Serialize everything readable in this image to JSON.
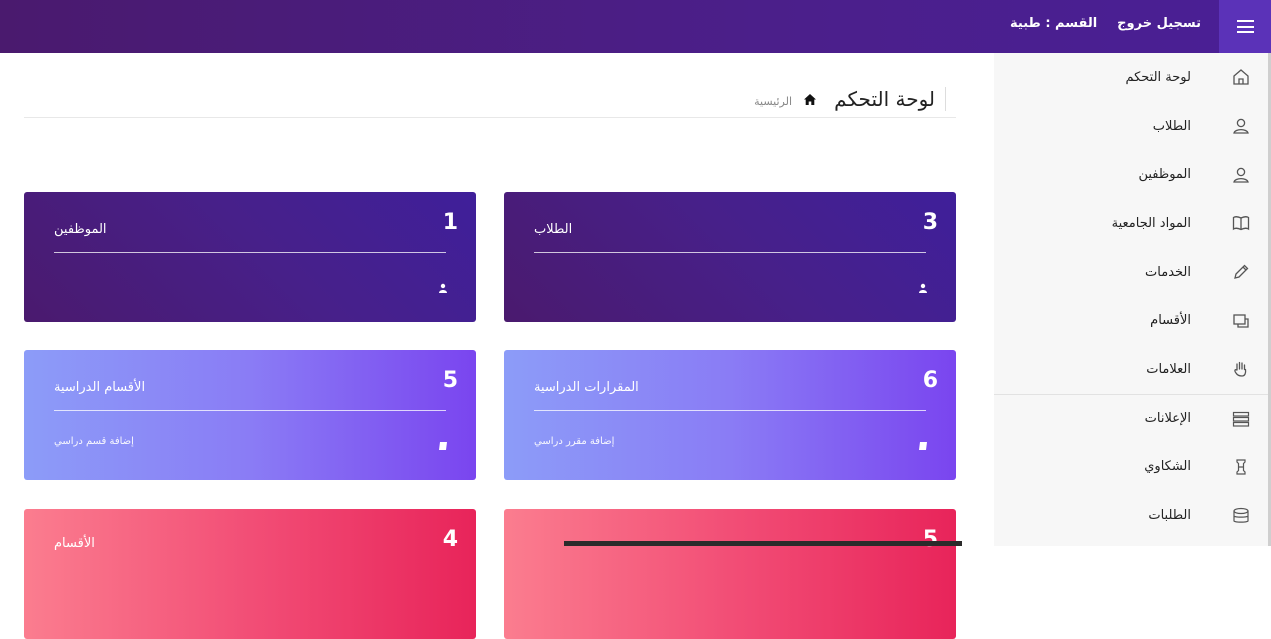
{
  "topbar": {
    "logout_label": "تسجيل خروج",
    "section_label": "القسم : ",
    "section_value": "طبية"
  },
  "sidebar": {
    "items": [
      {
        "label": "لوحة التحكم",
        "icon": "home-icon"
      },
      {
        "label": "الطلاب",
        "icon": "user-icon"
      },
      {
        "label": "الموظفين",
        "icon": "user-icon"
      },
      {
        "label": "المواد الجامعية",
        "icon": "book-icon"
      },
      {
        "label": "الخدمات",
        "icon": "pencil-icon"
      },
      {
        "label": "الأقسام",
        "icon": "windows-icon"
      },
      {
        "label": "العلامات",
        "icon": "hand-icon"
      },
      {
        "label": "الإعلانات",
        "icon": "list-icon"
      },
      {
        "label": "الشكاوي",
        "icon": "tower-icon"
      },
      {
        "label": "الطلبات",
        "icon": "database-icon"
      }
    ]
  },
  "page": {
    "title": "لوحة التحكم",
    "breadcrumb_home": "الرئيسية"
  },
  "cards": [
    {
      "value": "3",
      "title": "الطلاب",
      "footer": "",
      "theme": "purple"
    },
    {
      "value": "1",
      "title": "الموظفين",
      "footer": "",
      "theme": "purple"
    },
    {
      "value": "6",
      "title": "المقرارات الدراسية",
      "footer": "إضافة مقرر دراسي",
      "theme": "violet"
    },
    {
      "value": "5",
      "title": "الأقسام الدراسية",
      "footer": "إضافة قسم دراسي",
      "theme": "violet"
    },
    {
      "value": "5",
      "title": "",
      "footer": "",
      "theme": "pink"
    },
    {
      "value": "4",
      "title": "الأقسام",
      "footer": "",
      "theme": "pink"
    }
  ],
  "colors": {
    "topbar": "#4b1f8a",
    "menu_button": "#5b32b8",
    "purple_card": "#47208a",
    "violet_card": "#8a7cf5",
    "pink_card": "#f24e76"
  }
}
